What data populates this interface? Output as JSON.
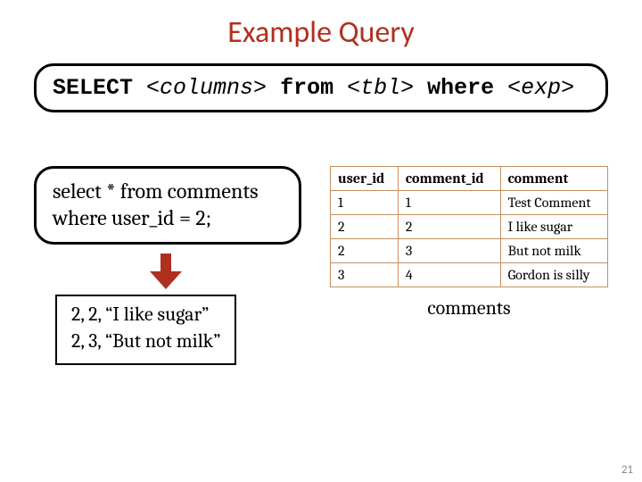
{
  "title": "Example Query",
  "syntax": {
    "select": "SELECT",
    "cols": "<columns>",
    "from": "from",
    "tbl": "<tbl>",
    "where": "where",
    "exp": "<exp>"
  },
  "query": {
    "line1": "select * from comments",
    "line2": "where user_id = 2;"
  },
  "table": {
    "headers": [
      "user_id",
      "comment_id",
      "comment"
    ],
    "rows": [
      [
        "1",
        "1",
        "Test Comment"
      ],
      [
        "2",
        "2",
        "I like sugar"
      ],
      [
        "2",
        "3",
        "But not milk"
      ],
      [
        "3",
        "4",
        "Gordon is silly"
      ]
    ],
    "caption": "comments"
  },
  "result": {
    "line1": "2, 2, “I like sugar”",
    "line2": "2, 3, “But not milk”"
  },
  "page_number": "21"
}
